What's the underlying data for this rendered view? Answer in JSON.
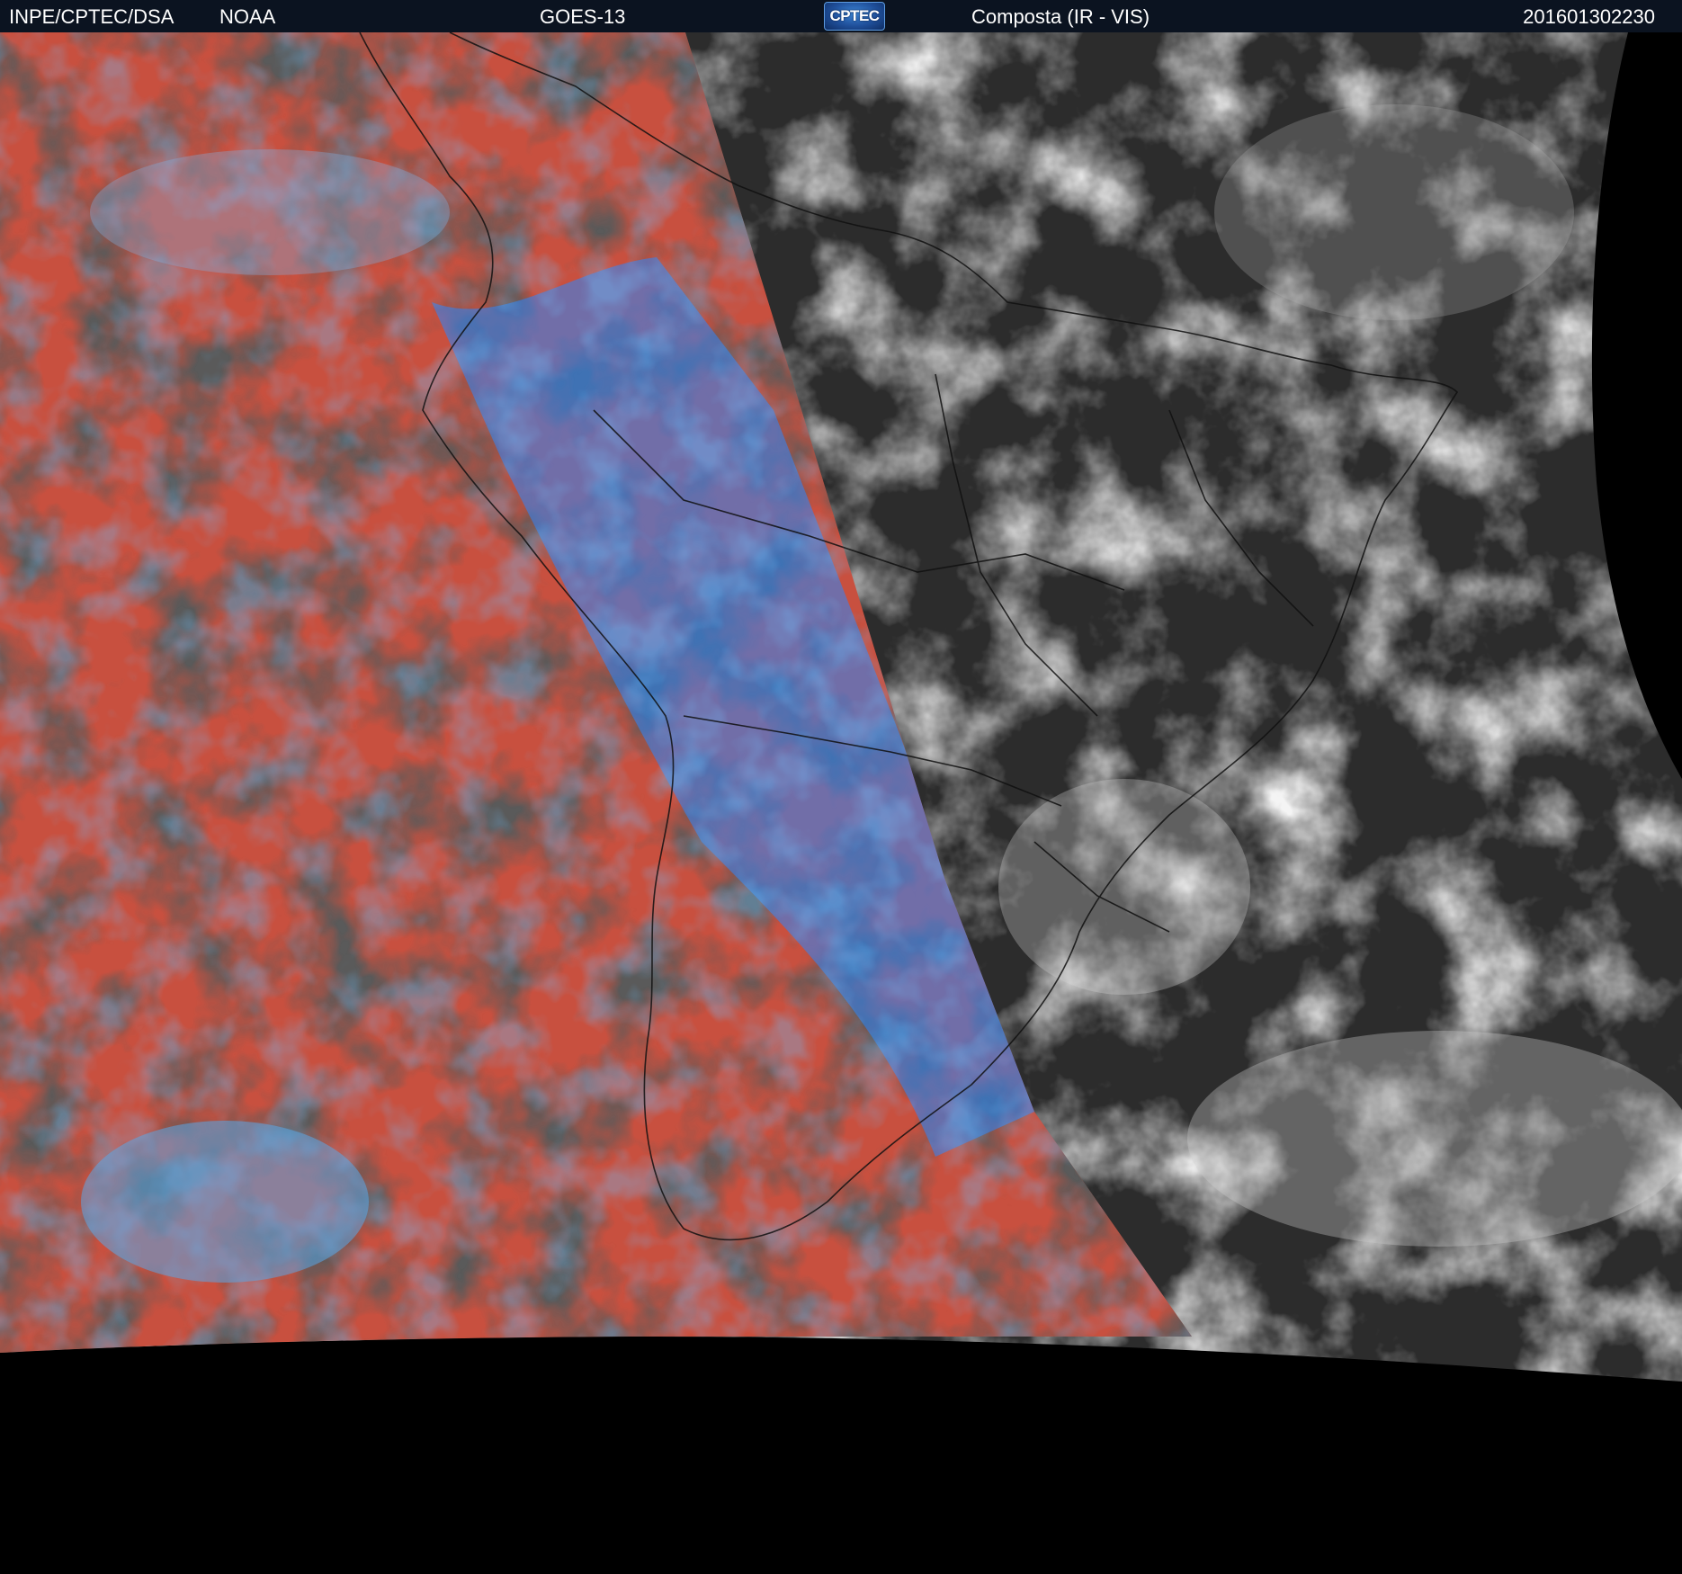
{
  "header": {
    "source": "INPE/CPTEC/DSA",
    "agency": "NOAA",
    "satellite": "GOES-13",
    "logo_text": "CPTEC",
    "product": "Composta (IR - VIS)",
    "timestamp": "201601302230"
  },
  "image": {
    "subject": "satellite-composite-south-america",
    "colors": {
      "ir_background": "#c8503f",
      "ir_cold_clouds": "#2a86ff",
      "ir_warm_clouds": "#1a1a1a",
      "vis_background": "#2c2c2c",
      "vis_clouds": "#e0e0e0",
      "space": "#000000"
    }
  }
}
